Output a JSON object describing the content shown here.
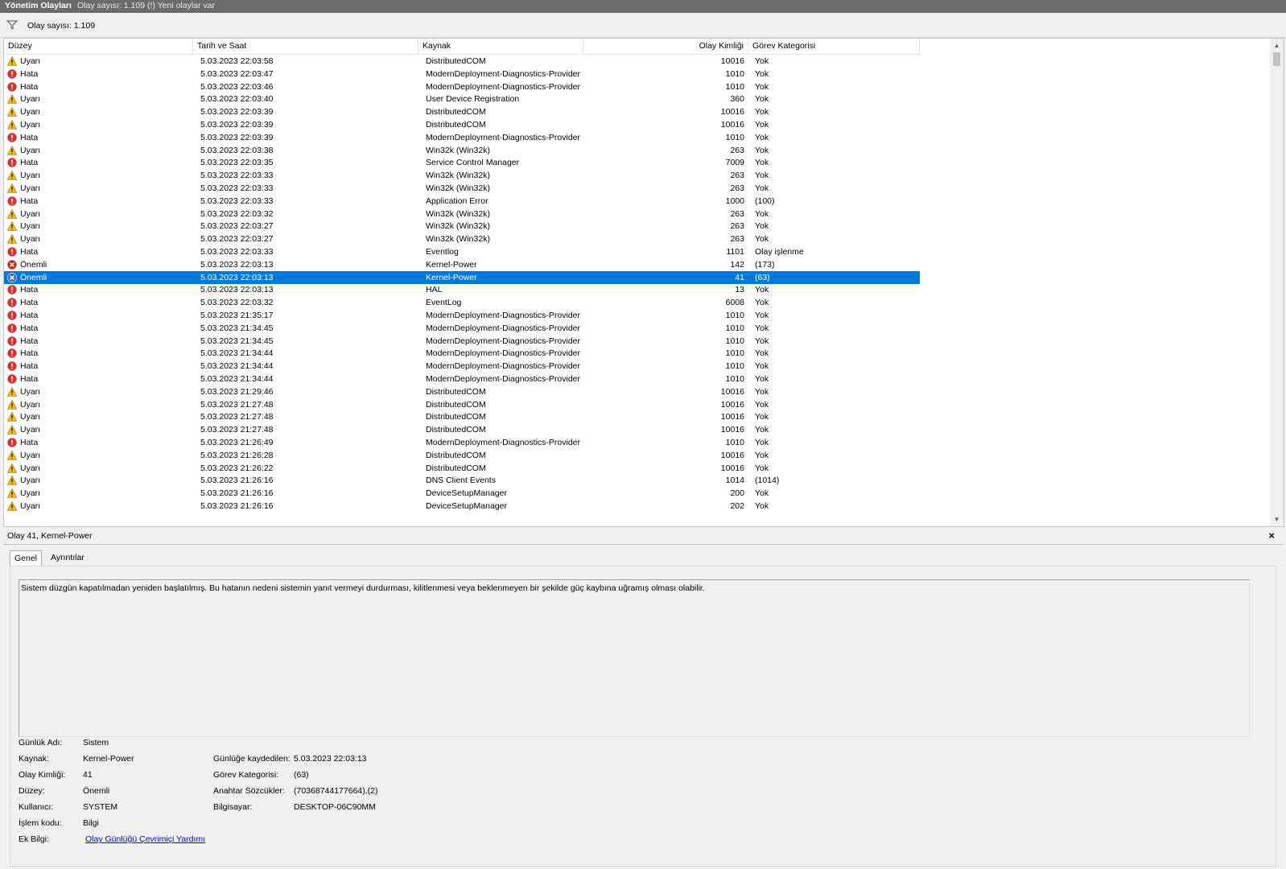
{
  "titlebar": {
    "title": "Yönetim Olayları",
    "subtitle": "Olay sayısı: 1.109 (!) Yeni olaylar var"
  },
  "filterbar": {
    "filter_count": "Olay sayısı: 1.109"
  },
  "columns": {
    "level": "Düzey",
    "datetime": "Tarih ve Saat",
    "source": "Kaynak",
    "event_id": "Olay Kimliği",
    "category": "Görev Kategorisi"
  },
  "events": [
    {
      "type": "warning",
      "level": "Uyarı",
      "datetime": "5.03.2023 22:03:58",
      "source": "DistributedCOM",
      "event_id": "10016",
      "category": "Yok"
    },
    {
      "type": "error",
      "level": "Hata",
      "datetime": "5.03.2023 22:03:47",
      "source": "ModernDeployment-Diagnostics-Provider",
      "event_id": "1010",
      "category": "Yok"
    },
    {
      "type": "error",
      "level": "Hata",
      "datetime": "5.03.2023 22:03:46",
      "source": "ModernDeployment-Diagnostics-Provider",
      "event_id": "1010",
      "category": "Yok"
    },
    {
      "type": "warning",
      "level": "Uyarı",
      "datetime": "5.03.2023 22:03:40",
      "source": "User Device Registration",
      "event_id": "360",
      "category": "Yok"
    },
    {
      "type": "warning",
      "level": "Uyarı",
      "datetime": "5.03.2023 22:03:39",
      "source": "DistributedCOM",
      "event_id": "10016",
      "category": "Yok"
    },
    {
      "type": "warning",
      "level": "Uyarı",
      "datetime": "5.03.2023 22:03:39",
      "source": "DistributedCOM",
      "event_id": "10016",
      "category": "Yok"
    },
    {
      "type": "error",
      "level": "Hata",
      "datetime": "5.03.2023 22:03:39",
      "source": "ModernDeployment-Diagnostics-Provider",
      "event_id": "1010",
      "category": "Yok"
    },
    {
      "type": "warning",
      "level": "Uyarı",
      "datetime": "5.03.2023 22:03:38",
      "source": "Win32k (Win32k)",
      "event_id": "263",
      "category": "Yok"
    },
    {
      "type": "error",
      "level": "Hata",
      "datetime": "5.03.2023 22:03:35",
      "source": "Service Control Manager",
      "event_id": "7009",
      "category": "Yok"
    },
    {
      "type": "warning",
      "level": "Uyarı",
      "datetime": "5.03.2023 22:03:33",
      "source": "Win32k (Win32k)",
      "event_id": "263",
      "category": "Yok"
    },
    {
      "type": "warning",
      "level": "Uyarı",
      "datetime": "5.03.2023 22:03:33",
      "source": "Win32k (Win32k)",
      "event_id": "263",
      "category": "Yok"
    },
    {
      "type": "error",
      "level": "Hata",
      "datetime": "5.03.2023 22:03:33",
      "source": "Application Error",
      "event_id": "1000",
      "category": "(100)"
    },
    {
      "type": "warning",
      "level": "Uyarı",
      "datetime": "5.03.2023 22:03:32",
      "source": "Win32k (Win32k)",
      "event_id": "263",
      "category": "Yok"
    },
    {
      "type": "warning",
      "level": "Uyarı",
      "datetime": "5.03.2023 22:03:27",
      "source": "Win32k (Win32k)",
      "event_id": "263",
      "category": "Yok"
    },
    {
      "type": "warning",
      "level": "Uyarı",
      "datetime": "5.03.2023 22:03:27",
      "source": "Win32k (Win32k)",
      "event_id": "263",
      "category": "Yok"
    },
    {
      "type": "error",
      "level": "Hata",
      "datetime": "5.03.2023 22:03:33",
      "source": "Eventlog",
      "event_id": "1101",
      "category": "Olay işlenme"
    },
    {
      "type": "critical",
      "level": "Önemli",
      "datetime": "5.03.2023 22:03:13",
      "source": "Kernel-Power",
      "event_id": "142",
      "category": "(173)"
    },
    {
      "type": "critical",
      "level": "Önemli",
      "datetime": "5.03.2023 22:03:13",
      "source": "Kernel-Power",
      "event_id": "41",
      "category": "(63)",
      "selected": true
    },
    {
      "type": "error",
      "level": "Hata",
      "datetime": "5.03.2023 22:03:13",
      "source": "HAL",
      "event_id": "13",
      "category": "Yok"
    },
    {
      "type": "error",
      "level": "Hata",
      "datetime": "5.03.2023 22:03:32",
      "source": "EventLog",
      "event_id": "6008",
      "category": "Yok"
    },
    {
      "type": "error",
      "level": "Hata",
      "datetime": "5.03.2023 21:35:17",
      "source": "ModernDeployment-Diagnostics-Provider",
      "event_id": "1010",
      "category": "Yok"
    },
    {
      "type": "error",
      "level": "Hata",
      "datetime": "5.03.2023 21:34:45",
      "source": "ModernDeployment-Diagnostics-Provider",
      "event_id": "1010",
      "category": "Yok"
    },
    {
      "type": "error",
      "level": "Hata",
      "datetime": "5.03.2023 21:34:45",
      "source": "ModernDeployment-Diagnostics-Provider",
      "event_id": "1010",
      "category": "Yok"
    },
    {
      "type": "error",
      "level": "Hata",
      "datetime": "5.03.2023 21:34:44",
      "source": "ModernDeployment-Diagnostics-Provider",
      "event_id": "1010",
      "category": "Yok"
    },
    {
      "type": "error",
      "level": "Hata",
      "datetime": "5.03.2023 21:34:44",
      "source": "ModernDeployment-Diagnostics-Provider",
      "event_id": "1010",
      "category": "Yok"
    },
    {
      "type": "error",
      "level": "Hata",
      "datetime": "5.03.2023 21:34:44",
      "source": "ModernDeployment-Diagnostics-Provider",
      "event_id": "1010",
      "category": "Yok"
    },
    {
      "type": "warning",
      "level": "Uyarı",
      "datetime": "5.03.2023 21:29:46",
      "source": "DistributedCOM",
      "event_id": "10016",
      "category": "Yok"
    },
    {
      "type": "warning",
      "level": "Uyarı",
      "datetime": "5.03.2023 21:27:48",
      "source": "DistributedCOM",
      "event_id": "10016",
      "category": "Yok"
    },
    {
      "type": "warning",
      "level": "Uyarı",
      "datetime": "5.03.2023 21:27:48",
      "source": "DistributedCOM",
      "event_id": "10016",
      "category": "Yok"
    },
    {
      "type": "warning",
      "level": "Uyarı",
      "datetime": "5.03.2023 21:27:48",
      "source": "DistributedCOM",
      "event_id": "10016",
      "category": "Yok"
    },
    {
      "type": "error",
      "level": "Hata",
      "datetime": "5.03.2023 21:26:49",
      "source": "ModernDeployment-Diagnostics-Provider",
      "event_id": "1010",
      "category": "Yok"
    },
    {
      "type": "warning",
      "level": "Uyarı",
      "datetime": "5.03.2023 21:26:28",
      "source": "DistributedCOM",
      "event_id": "10016",
      "category": "Yok"
    },
    {
      "type": "warning",
      "level": "Uyarı",
      "datetime": "5.03.2023 21:26:22",
      "source": "DistributedCOM",
      "event_id": "10016",
      "category": "Yok"
    },
    {
      "type": "warning",
      "level": "Uyarı",
      "datetime": "5.03.2023 21:26:16",
      "source": "DNS Client Events",
      "event_id": "1014",
      "category": "(1014)"
    },
    {
      "type": "warning",
      "level": "Uyarı",
      "datetime": "5.03.2023 21:26:16",
      "source": "DeviceSetupManager",
      "event_id": "200",
      "category": "Yok"
    },
    {
      "type": "warning",
      "level": "Uyarı",
      "datetime": "5.03.2023 21:26:16",
      "source": "DeviceSetupManager",
      "event_id": "202",
      "category": "Yok"
    }
  ],
  "detail": {
    "header_title": "Olay 41, Kernel-Power",
    "close_glyph": "×",
    "tabs": {
      "general": "Genel",
      "details": "Ayrıntılar"
    },
    "description": "Sistem düzgün kapatılmadan yeniden başlatılmış. Bu hatanın nedeni sistemin yanıt vermeyi durdurması, kilitlenmesi veya beklenmeyen bir şekilde güç kaybına uğramış olması olabilir.",
    "props": {
      "log_name_label": "Günlük Adı:",
      "log_name": "Sistem",
      "source_label": "Kaynak:",
      "source": "Kernel-Power",
      "logged_label": "Günlüğe kaydedilen:",
      "logged": "5.03.2023 22:03:13",
      "event_id_label": "Olay Kimliği:",
      "event_id": "41",
      "task_category_label": "Görev Kategorisi:",
      "task_category": "(63)",
      "level_label": "Düzey:",
      "level": "Önemli",
      "keywords_label": "Anahtar Sözcükler:",
      "keywords": "(70368744177664),(2)",
      "user_label": "Kullanıcı:",
      "user": "SYSTEM",
      "computer_label": "Bilgisayar:",
      "computer": "DESKTOP-06C90MM",
      "opcode_label": "İşlem kodu:",
      "opcode": "Bilgi",
      "more_info_label": "Ek Bilgi:",
      "more_info_link": "Olay Günlüğü Çevrimiçi Yardımı"
    }
  },
  "colors": {
    "selection": "#0078d7",
    "warning": "#f5c211",
    "error": "#d13438",
    "critical": "#c42b1c",
    "link": "#0000ee",
    "titlebar": "#6b6b6b"
  }
}
